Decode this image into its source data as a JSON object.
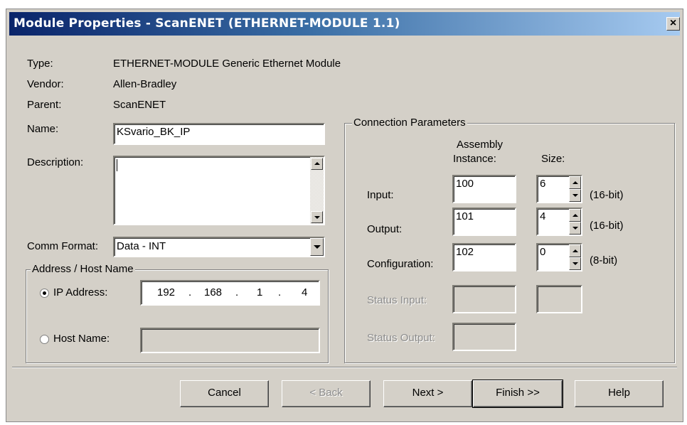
{
  "window": {
    "title": "Module Properties  - ScanENET (ETHERNET-MODULE 1.1)",
    "close_glyph": "×"
  },
  "info": {
    "type_label": "Type:",
    "type_value": "ETHERNET-MODULE Generic Ethernet Module",
    "vendor_label": "Vendor:",
    "vendor_value": "Allen-Bradley",
    "parent_label": "Parent:",
    "parent_value": "ScanENET"
  },
  "name": {
    "label": "Name:",
    "value": "KSvario_BK_IP"
  },
  "description": {
    "label": "Description:",
    "value": ""
  },
  "comm_format": {
    "label": "Comm Format:",
    "value": "Data - INT"
  },
  "address": {
    "group_title": "Address / Host Name",
    "ip_label": "IP Address:",
    "ip_octets": [
      "192",
      "168",
      "1",
      "4"
    ],
    "ip_dot": ".",
    "host_label": "Host Name:",
    "host_value": "",
    "selected": "ip"
  },
  "connection": {
    "group_title": "Connection Parameters",
    "assembly_header_1": "Assembly",
    "assembly_header_2": "Instance:",
    "size_header": "Size:",
    "rows": [
      {
        "label": "Input:",
        "instance": "100",
        "size": "6",
        "unit": "(16-bit)"
      },
      {
        "label": "Output:",
        "instance": "101",
        "size": "4",
        "unit": "(16-bit)"
      },
      {
        "label": "Configuration:",
        "instance": "102",
        "size": "0",
        "unit": "(8-bit)"
      }
    ],
    "status_input_label": "Status Input:",
    "status_output_label": "Status Output:"
  },
  "buttons": {
    "cancel": "Cancel",
    "back": "< Back",
    "next": "Next >",
    "finish": "Finish >>",
    "help": "Help"
  }
}
